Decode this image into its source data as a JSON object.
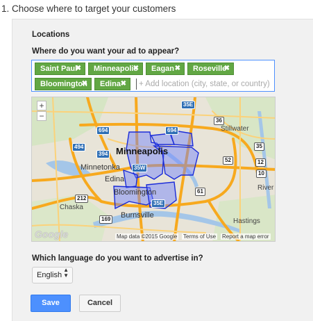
{
  "step": {
    "title": "1. Choose where to target your customers"
  },
  "locations": {
    "section_label": "Locations",
    "question": "Where do you want your ad to appear?",
    "chips": [
      {
        "label": "Saint Paul"
      },
      {
        "label": "Minneapolis"
      },
      {
        "label": "Eagan"
      },
      {
        "label": "Roseville"
      },
      {
        "label": "Bloomington"
      },
      {
        "label": "Edina"
      }
    ],
    "chip_remove": "✖",
    "add_placeholder": "+ Add location (city, state, or country)"
  },
  "map": {
    "zoom_in": "+",
    "zoom_out": "−",
    "cities": {
      "minneapolis": "Minneapolis",
      "minnetonka": "Minnetonka",
      "edina": "Edina",
      "bloomington": "Bloomington",
      "burnsville": "Burnsville",
      "chaska": "Chaska",
      "stillwater": "Stillwater",
      "river": "River",
      "hastings": "Hastings"
    },
    "shields": {
      "i694a": "694",
      "i694b": "694",
      "i494": "494",
      "i394": "394",
      "i35w": "35W",
      "i35e": "35E",
      "i35e_top": "35E",
      "us10": "10",
      "us61": "61",
      "us212": "212",
      "us169": "169",
      "us52": "52",
      "us12": "12",
      "r36": "36",
      "r35": "35"
    },
    "footer": {
      "google": "Google",
      "map_data": "Map data ©2015 Google",
      "terms": "Terms of Use",
      "report": "Report a map error"
    },
    "colors": {
      "road": "#f4b23a",
      "highway": "#f7a91e",
      "water": "#a4c6e8",
      "region": "#6c7fff"
    }
  },
  "language": {
    "question": "Which language do you want to advertise in?",
    "selected": "English"
  },
  "actions": {
    "save": "Save",
    "cancel": "Cancel"
  }
}
